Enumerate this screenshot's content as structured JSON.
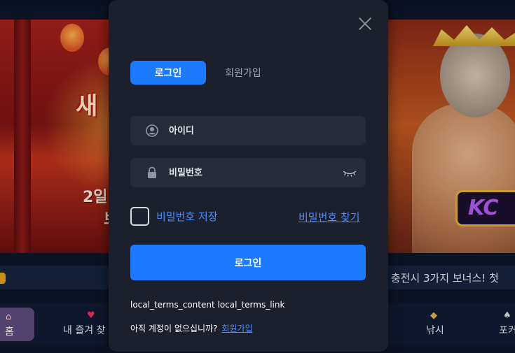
{
  "background": {
    "left_banner": {
      "headline": "새",
      "line1": "2일",
      "line2": "보"
    },
    "right_banner": {
      "badge": "KC"
    },
    "ticker": {
      "text": "! 충전시 3가지 보너스! 첫"
    },
    "bottom_nav": [
      {
        "label": "홈",
        "icon": "home-icon"
      },
      {
        "label": "내 즐겨 찾",
        "icon": "heart-icon"
      },
      {
        "label": "낚시",
        "icon": "fish-icon"
      },
      {
        "label": "포커",
        "icon": "cards-icon"
      }
    ]
  },
  "modal": {
    "tabs": {
      "login": "로그인",
      "signup": "회원가입"
    },
    "id_field": {
      "placeholder": "아이디",
      "value": ""
    },
    "password_field": {
      "placeholder": "비밀번호",
      "value": ""
    },
    "remember_label": "비밀번호 저장",
    "remember_checked": false,
    "find_password": "비밀번호 찾기",
    "login_button": "로그인",
    "terms_content": "local_terms_content",
    "terms_link": "local_terms_link",
    "no_account_text": "아직 계정이 없으십니까?",
    "signup_link": "회원가입"
  },
  "colors": {
    "accent": "#1d7bff",
    "link": "#4c8dff",
    "modal_bg": "#1b202c",
    "field_bg": "#252b39"
  }
}
